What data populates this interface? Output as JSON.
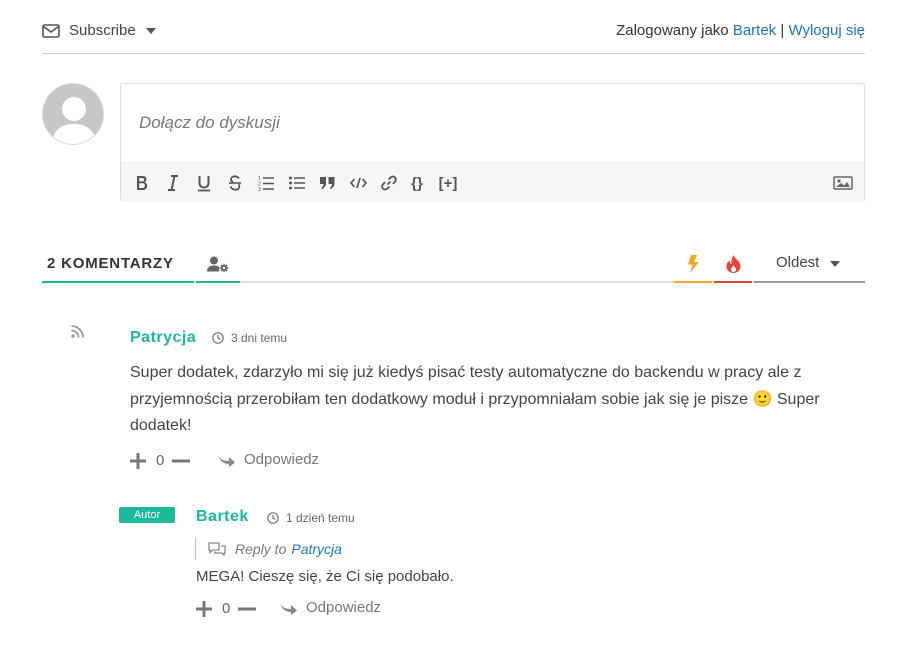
{
  "header": {
    "subscribe_label": "Subscribe",
    "login_prefix": "Zalogowany jako",
    "user_name": "Bartek",
    "separator": "|",
    "logout_label": "Wyloguj się"
  },
  "editor": {
    "placeholder": "Dołącz do dyskusji",
    "toolbar": [
      "bold-icon",
      "italic-icon",
      "underline-icon",
      "strikethrough-icon",
      "ordered-list-icon",
      "unordered-list-icon",
      "quote-icon",
      "code-icon",
      "link-icon",
      "source-code-icon",
      "spoiler-icon",
      "image-icon"
    ],
    "toolbar_text": {
      "source_code": "{}",
      "spoiler": "[+]"
    }
  },
  "tabs": {
    "count_label": "2 KOMENTARZY",
    "sort_label": "Oldest",
    "colors": {
      "active": "#1db99a",
      "hot": "#f6a623",
      "fire": "#e8443a"
    }
  },
  "comments": [
    {
      "author": "Patrycja",
      "date": "3 dni temu",
      "text": "Super dodatek, zdarzyło mi się już kiedyś pisać testy automatyczne do backendu w pracy ale z przyjemnością przerobiłam ten dodatkowy moduł i przypomniałam sobie jak się je pisze 🙂 Super dodatek!",
      "votes": "0",
      "reply_label": "Odpowiedz"
    },
    {
      "badge": "Autor",
      "author": "Bartek",
      "date": "1 dzień temu",
      "reply_to_prefix": "Reply to",
      "reply_to_name": "Patrycja",
      "text": "MEGA! Cieszę się, że Ci się podobało.",
      "votes": "0",
      "reply_label": "Odpowiedz"
    }
  ]
}
